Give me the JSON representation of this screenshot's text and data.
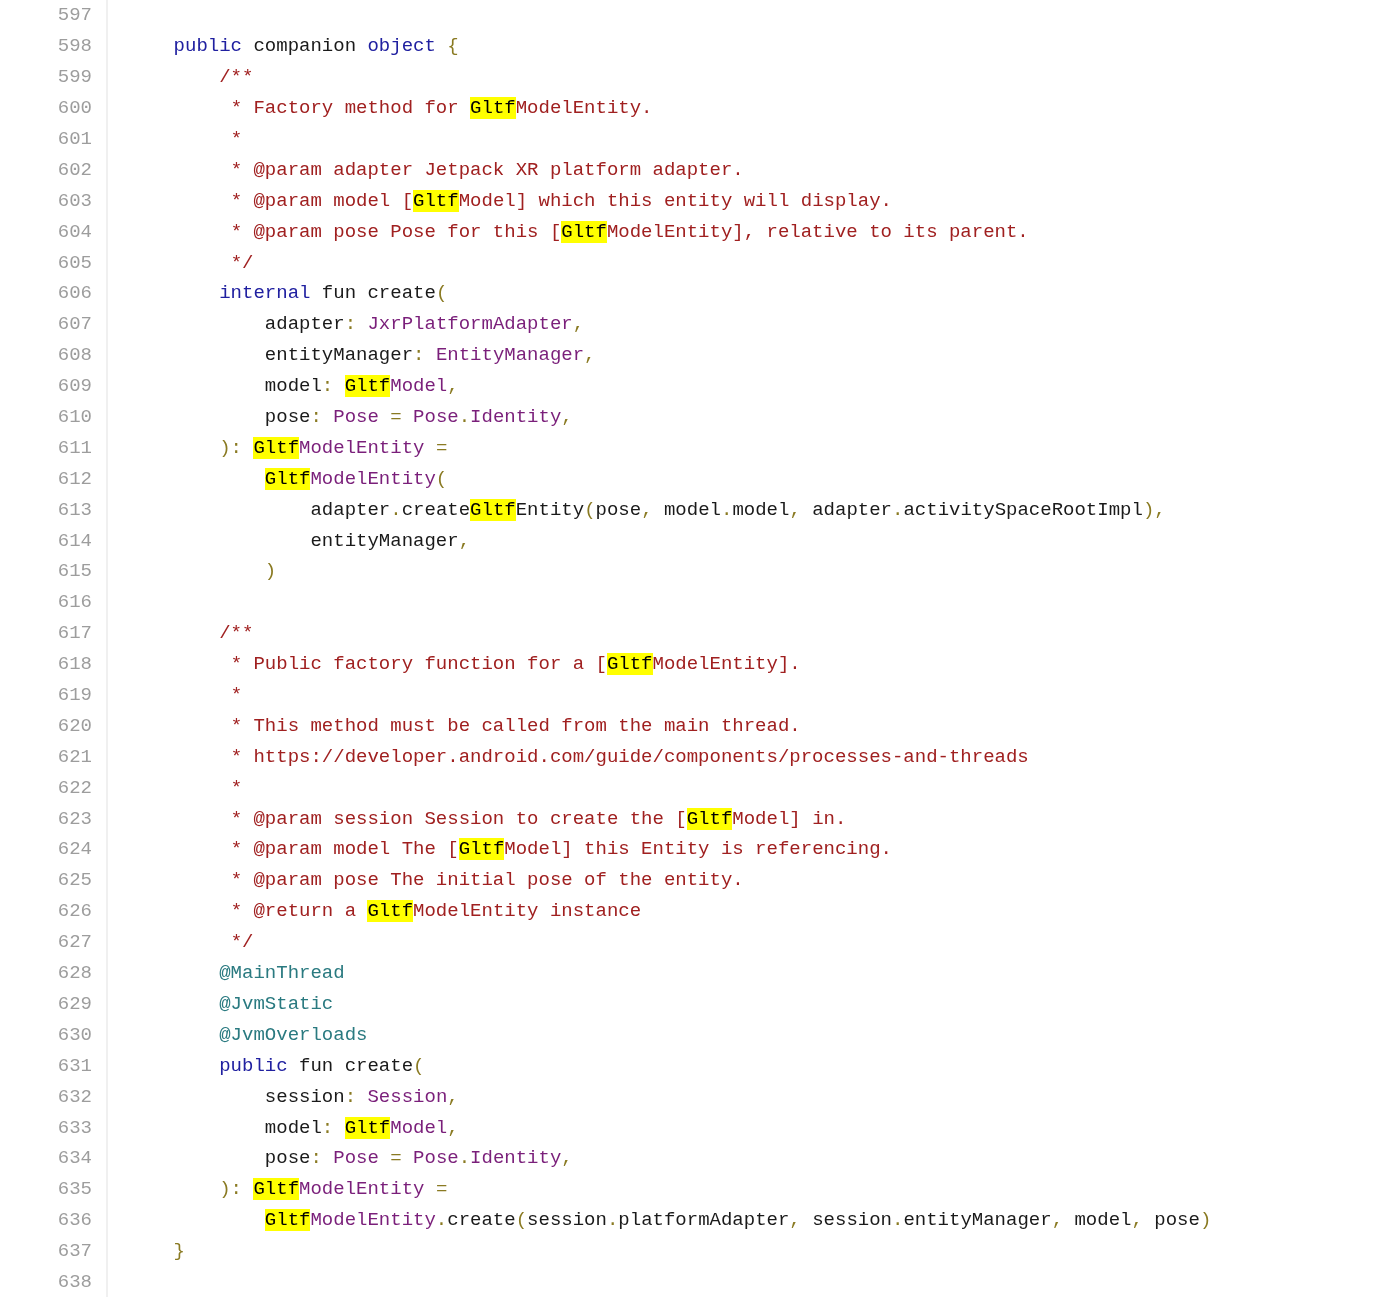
{
  "code_lines": [
    {
      "number": "597"
    },
    {
      "number": "598",
      "tokens": [
        {
          "kind": "keyword",
          "text": "    public"
        },
        {
          "kind": "plain",
          "text": " companion "
        },
        {
          "kind": "keyword",
          "text": "object"
        },
        {
          "kind": "punct",
          "text": " {"
        }
      ]
    },
    {
      "number": "599",
      "tokens": [
        {
          "kind": "comment",
          "text": "        /**"
        }
      ]
    },
    {
      "number": "600",
      "tokens": [
        {
          "kind": "comment",
          "text": "         * Factory method for "
        },
        {
          "kind": "match",
          "text": "Gltf"
        },
        {
          "kind": "comment",
          "text": "ModelEntity."
        }
      ]
    },
    {
      "number": "601",
      "tokens": [
        {
          "kind": "comment",
          "text": "         *"
        }
      ]
    },
    {
      "number": "602",
      "tokens": [
        {
          "kind": "comment",
          "text": "         * @param adapter Jetpack XR platform adapter."
        }
      ]
    },
    {
      "number": "603",
      "tokens": [
        {
          "kind": "comment",
          "text": "         * @param model ["
        },
        {
          "kind": "match",
          "text": "Gltf"
        },
        {
          "kind": "comment",
          "text": "Model] which this entity will display."
        }
      ]
    },
    {
      "number": "604",
      "tokens": [
        {
          "kind": "comment",
          "text": "         * @param pose Pose for this ["
        },
        {
          "kind": "match",
          "text": "Gltf"
        },
        {
          "kind": "comment",
          "text": "ModelEntity], relative to its parent."
        }
      ]
    },
    {
      "number": "605",
      "tokens": [
        {
          "kind": "comment",
          "text": "         */"
        }
      ]
    },
    {
      "number": "606",
      "tokens": [
        {
          "kind": "keyword",
          "text": "        internal"
        },
        {
          "kind": "plain",
          "text": " fun create"
        },
        {
          "kind": "punct",
          "text": "("
        }
      ]
    },
    {
      "number": "607",
      "tokens": [
        {
          "kind": "plain",
          "text": "            adapter"
        },
        {
          "kind": "punct",
          "text": ": "
        },
        {
          "kind": "type",
          "text": "JxrPlatformAdapter"
        },
        {
          "kind": "punct",
          "text": ","
        }
      ]
    },
    {
      "number": "608",
      "tokens": [
        {
          "kind": "plain",
          "text": "            entityManager"
        },
        {
          "kind": "punct",
          "text": ": "
        },
        {
          "kind": "type",
          "text": "EntityManager"
        },
        {
          "kind": "punct",
          "text": ","
        }
      ]
    },
    {
      "number": "609",
      "tokens": [
        {
          "kind": "plain",
          "text": "            model"
        },
        {
          "kind": "punct",
          "text": ": "
        },
        {
          "kind": "match",
          "text": "Gltf"
        },
        {
          "kind": "type",
          "text": "Model"
        },
        {
          "kind": "punct",
          "text": ","
        }
      ]
    },
    {
      "number": "610",
      "tokens": [
        {
          "kind": "plain",
          "text": "            pose"
        },
        {
          "kind": "punct",
          "text": ": "
        },
        {
          "kind": "type",
          "text": "Pose"
        },
        {
          "kind": "punct",
          "text": " = "
        },
        {
          "kind": "type",
          "text": "Pose"
        },
        {
          "kind": "punct",
          "text": "."
        },
        {
          "kind": "type",
          "text": "Identity"
        },
        {
          "kind": "punct",
          "text": ","
        }
      ]
    },
    {
      "number": "611",
      "tokens": [
        {
          "kind": "punct",
          "text": "        ): "
        },
        {
          "kind": "match",
          "text": "Gltf"
        },
        {
          "kind": "type",
          "text": "ModelEntity"
        },
        {
          "kind": "punct",
          "text": " ="
        }
      ]
    },
    {
      "number": "612",
      "tokens": [
        {
          "kind": "match",
          "text": "            Gltf"
        },
        {
          "kind": "type",
          "text": "ModelEntity"
        },
        {
          "kind": "punct",
          "text": "("
        }
      ]
    },
    {
      "number": "613",
      "tokens": [
        {
          "kind": "plain",
          "text": "                adapter"
        },
        {
          "kind": "punct",
          "text": "."
        },
        {
          "kind": "plain",
          "text": "create"
        },
        {
          "kind": "match",
          "text": "Gltf"
        },
        {
          "kind": "plain",
          "text": "Entity"
        },
        {
          "kind": "punct",
          "text": "("
        },
        {
          "kind": "plain",
          "text": "pose"
        },
        {
          "kind": "punct",
          "text": ", "
        },
        {
          "kind": "plain",
          "text": "model"
        },
        {
          "kind": "punct",
          "text": "."
        },
        {
          "kind": "plain",
          "text": "model"
        },
        {
          "kind": "punct",
          "text": ", "
        },
        {
          "kind": "plain",
          "text": "adapter"
        },
        {
          "kind": "punct",
          "text": "."
        },
        {
          "kind": "plain",
          "text": "activitySpaceRootImpl"
        },
        {
          "kind": "punct",
          "text": "),"
        }
      ]
    },
    {
      "number": "614",
      "tokens": [
        {
          "kind": "plain",
          "text": "                entityManager"
        },
        {
          "kind": "punct",
          "text": ","
        }
      ]
    },
    {
      "number": "615",
      "tokens": [
        {
          "kind": "punct",
          "text": "            )"
        }
      ]
    },
    {
      "number": "616"
    },
    {
      "number": "617",
      "tokens": [
        {
          "kind": "comment",
          "text": "        /**"
        }
      ]
    },
    {
      "number": "618",
      "tokens": [
        {
          "kind": "comment",
          "text": "         * Public factory function for a ["
        },
        {
          "kind": "match",
          "text": "Gltf"
        },
        {
          "kind": "comment",
          "text": "ModelEntity]."
        }
      ]
    },
    {
      "number": "619",
      "tokens": [
        {
          "kind": "comment",
          "text": "         *"
        }
      ]
    },
    {
      "number": "620",
      "tokens": [
        {
          "kind": "comment",
          "text": "         * This method must be called from the main thread."
        }
      ]
    },
    {
      "number": "621",
      "tokens": [
        {
          "kind": "comment",
          "text": "         * https://developer.android.com/guide/components/processes-and-threads"
        }
      ]
    },
    {
      "number": "622",
      "tokens": [
        {
          "kind": "comment",
          "text": "         *"
        }
      ]
    },
    {
      "number": "623",
      "tokens": [
        {
          "kind": "comment",
          "text": "         * @param session Session to create the ["
        },
        {
          "kind": "match",
          "text": "Gltf"
        },
        {
          "kind": "comment",
          "text": "Model] in."
        }
      ]
    },
    {
      "number": "624",
      "tokens": [
        {
          "kind": "comment",
          "text": "         * @param model The ["
        },
        {
          "kind": "match",
          "text": "Gltf"
        },
        {
          "kind": "comment",
          "text": "Model] this Entity is referencing."
        }
      ]
    },
    {
      "number": "625",
      "tokens": [
        {
          "kind": "comment",
          "text": "         * @param pose The initial pose of the entity."
        }
      ]
    },
    {
      "number": "626",
      "tokens": [
        {
          "kind": "comment",
          "text": "         * @return a "
        },
        {
          "kind": "match",
          "text": "Gltf"
        },
        {
          "kind": "comment",
          "text": "ModelEntity instance"
        }
      ]
    },
    {
      "number": "627",
      "tokens": [
        {
          "kind": "comment",
          "text": "         */"
        }
      ]
    },
    {
      "number": "628",
      "tokens": [
        {
          "kind": "annotation",
          "text": "        @MainThread"
        }
      ]
    },
    {
      "number": "629",
      "tokens": [
        {
          "kind": "annotation",
          "text": "        @JvmStatic"
        }
      ]
    },
    {
      "number": "630",
      "tokens": [
        {
          "kind": "annotation",
          "text": "        @JvmOverloads"
        }
      ]
    },
    {
      "number": "631",
      "tokens": [
        {
          "kind": "keyword",
          "text": "        public"
        },
        {
          "kind": "plain",
          "text": " fun create"
        },
        {
          "kind": "punct",
          "text": "("
        }
      ]
    },
    {
      "number": "632",
      "tokens": [
        {
          "kind": "plain",
          "text": "            session"
        },
        {
          "kind": "punct",
          "text": ": "
        },
        {
          "kind": "type",
          "text": "Session"
        },
        {
          "kind": "punct",
          "text": ","
        }
      ]
    },
    {
      "number": "633",
      "tokens": [
        {
          "kind": "plain",
          "text": "            model"
        },
        {
          "kind": "punct",
          "text": ": "
        },
        {
          "kind": "match",
          "text": "Gltf"
        },
        {
          "kind": "type",
          "text": "Model"
        },
        {
          "kind": "punct",
          "text": ","
        }
      ]
    },
    {
      "number": "634",
      "tokens": [
        {
          "kind": "plain",
          "text": "            pose"
        },
        {
          "kind": "punct",
          "text": ": "
        },
        {
          "kind": "type",
          "text": "Pose"
        },
        {
          "kind": "punct",
          "text": " = "
        },
        {
          "kind": "type",
          "text": "Pose"
        },
        {
          "kind": "punct",
          "text": "."
        },
        {
          "kind": "type",
          "text": "Identity"
        },
        {
          "kind": "punct",
          "text": ","
        }
      ]
    },
    {
      "number": "635",
      "tokens": [
        {
          "kind": "punct",
          "text": "        ): "
        },
        {
          "kind": "match",
          "text": "Gltf"
        },
        {
          "kind": "type",
          "text": "ModelEntity"
        },
        {
          "kind": "punct",
          "text": " ="
        }
      ]
    },
    {
      "number": "636",
      "tokens": [
        {
          "kind": "match",
          "text": "            Gltf"
        },
        {
          "kind": "type",
          "text": "ModelEntity"
        },
        {
          "kind": "punct",
          "text": "."
        },
        {
          "kind": "plain",
          "text": "create"
        },
        {
          "kind": "punct",
          "text": "("
        },
        {
          "kind": "plain",
          "text": "session"
        },
        {
          "kind": "punct",
          "text": "."
        },
        {
          "kind": "plain",
          "text": "platformAdapter"
        },
        {
          "kind": "punct",
          "text": ", "
        },
        {
          "kind": "plain",
          "text": "session"
        },
        {
          "kind": "punct",
          "text": "."
        },
        {
          "kind": "plain",
          "text": "entityManager"
        },
        {
          "kind": "punct",
          "text": ", "
        },
        {
          "kind": "plain",
          "text": "model"
        },
        {
          "kind": "punct",
          "text": ", "
        },
        {
          "kind": "plain",
          "text": "pose"
        },
        {
          "kind": "punct",
          "text": ")"
        }
      ]
    },
    {
      "number": "637",
      "tokens": [
        {
          "kind": "punct",
          "text": "    }"
        }
      ]
    },
    {
      "number": "638"
    }
  ]
}
